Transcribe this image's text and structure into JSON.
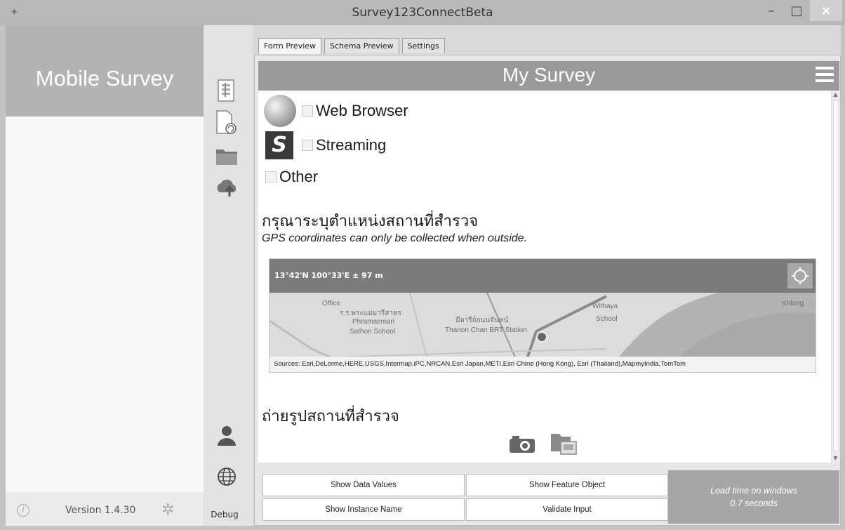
{
  "window": {
    "title": "Survey123ConnectBeta",
    "minimize": "–",
    "maximize": "□",
    "close": "×"
  },
  "sidebar": {
    "brand": "Mobile Survey",
    "version": "Version 1.4.30",
    "info_icon": "i"
  },
  "toolbar": {
    "icons": [
      "form-icon",
      "refresh-doc-icon",
      "folder-icon",
      "cloud-upload-icon",
      "user-icon",
      "globe-icon"
    ],
    "debug_label": "Debug"
  },
  "tabs": [
    {
      "label": "Form Preview",
      "active": true
    },
    {
      "label": "Schema Preview",
      "active": false
    },
    {
      "label": "Settings",
      "active": false
    }
  ],
  "survey": {
    "title": "My Survey",
    "options": [
      {
        "label": "Web Browser",
        "icon": "globe-icon"
      },
      {
        "label": "Streaming",
        "icon": "streaming-icon"
      },
      {
        "label": "Other",
        "icon": ""
      }
    ],
    "stream_glyph": "S",
    "location_question": "กรุณาระบุตำแหน่งสถานที่สำรวจ",
    "location_hint": "GPS coordinates can only be collected when outside.",
    "map": {
      "coordinates": "13°42'N 100°33'E ± 97 m",
      "labels": [
        "Office",
        "ร.ร.พระแม่มารีสาทร",
        "Phramaemari",
        "Sathon School",
        "มีอารีย์ถนนจันทน์",
        "Thanon Chan BRT Station",
        "Withaya",
        "School",
        "Khlong"
      ],
      "sources": "Sources: Esri,DeLorme,HERE,USGS,Intermap,iPC,NRCAN,Esri Japan,METI,Esri Chine (Hong Kong), Esri (Thailand),MapmyIndia,TomTom"
    },
    "photo_question": "ถ่ายรูปสถานที่สำรวจ"
  },
  "buttons": {
    "show_data_values": "Show Data Values",
    "show_feature_object": "Show Feature Object",
    "show_instance_name": "Show Instance Name",
    "validate_input": "Validate Input"
  },
  "load_time": {
    "line1": "Load time on windows",
    "line2": "0.7 seconds"
  }
}
